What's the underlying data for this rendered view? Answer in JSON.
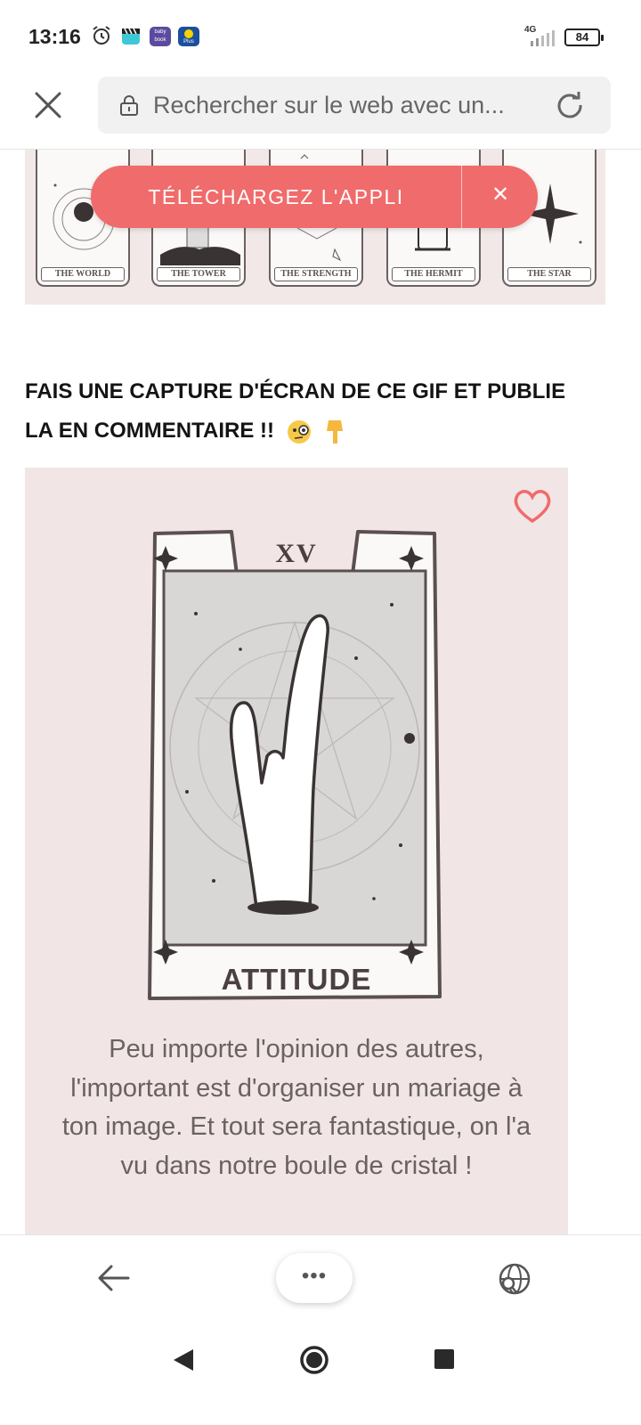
{
  "status_bar": {
    "time": "13:16",
    "network": "4G",
    "battery": "84",
    "icons": [
      "alarm-icon",
      "clapper-app-icon",
      "babybook-app-icon",
      "lidl-plus-app-icon",
      "signal-icon",
      "battery-icon"
    ],
    "app_badges": {
      "babybook": "baby book",
      "lidl": "Plus"
    }
  },
  "browser": {
    "url_placeholder": "Rechercher sur le web avec un...",
    "icons": [
      "close-icon",
      "lock-icon",
      "reload-icon"
    ]
  },
  "tarot_strip": {
    "cards": [
      "THE WORLD",
      "THE TOWER",
      "THE STRENGTH",
      "THE HERMIT",
      "THE STAR"
    ],
    "background_color": "#f3e8e8"
  },
  "banner": {
    "label": "TÉLÉCHARGEZ L'APPLI",
    "close": "✕",
    "color": "#f06b6b"
  },
  "article": {
    "heading": "FAIS UNE CAPTURE D'ÉCRAN DE CE GIF ET PUBLIE LA EN COMMENTAIRE !!",
    "heading_emojis": [
      "monocle-face-emoji",
      "pointing-down-emoji"
    ]
  },
  "gif_card": {
    "numeral": "XV",
    "title": "ATTITUDE",
    "caption": "Peu importe l'opinion des autres, l'important est d'organiser un mariage à ton image. Et tout sera fantastique, on l'a vu dans notre boule de cristal !",
    "background_color": "#f1e6e5",
    "heart_color": "#f06b6b"
  },
  "bottom_nav": {
    "more": "•••",
    "icons": [
      "back-arrow-icon",
      "more-icon",
      "translate-icon"
    ]
  },
  "system_nav": {
    "icons": [
      "nav-back-icon",
      "nav-home-icon",
      "nav-recents-icon"
    ]
  }
}
